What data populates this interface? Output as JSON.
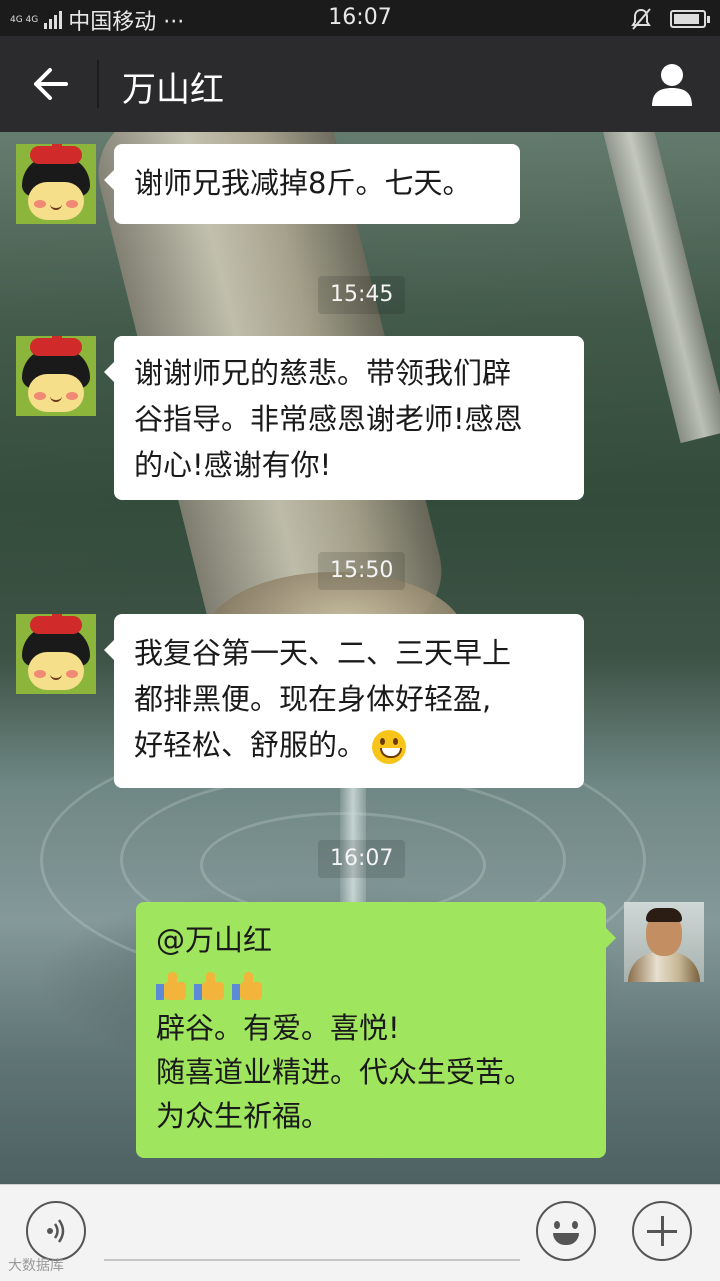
{
  "status_bar": {
    "network_top": "4G 4G",
    "carrier": "中国移动 ···",
    "time": "16:07",
    "battery_level": 0.9
  },
  "header": {
    "back_icon": "arrow-left-icon",
    "title": "万山红",
    "profile_icon": "person-icon"
  },
  "messages": [
    {
      "type": "received",
      "lines": [
        "谢师兄我减掉8斤。七天。"
      ]
    },
    {
      "type": "timestamp",
      "text": "15:45"
    },
    {
      "type": "received",
      "lines": [
        "谢谢师兄的慈悲。带领我们辟",
        "谷指导。非常感恩谢老师!感恩",
        "的心!感谢有你!"
      ]
    },
    {
      "type": "timestamp",
      "text": "15:50"
    },
    {
      "type": "received",
      "lines": [
        "我复谷第一天、二、三天早上",
        "都排黑便。现在身体好轻盈,",
        "好轻松、舒服的。"
      ],
      "emoji": "grinning-face-icon"
    },
    {
      "type": "timestamp",
      "text": "16:07"
    },
    {
      "type": "sent",
      "mention": "@万山红",
      "thumbs": 3,
      "lines": [
        "辟谷。有爱。喜悦!",
        "随喜道业精进。代众生受苦。",
        "为众生祈福。"
      ]
    }
  ],
  "footer": {
    "voice_icon": "voice-icon",
    "emoji_icon": "smiley-icon",
    "plus_icon": "plus-icon",
    "watermark": "大数据库"
  },
  "colors": {
    "titlebar": "#2b2b2d",
    "sent_bubble": "#9fe55d",
    "received_bubble": "#ffffff"
  }
}
